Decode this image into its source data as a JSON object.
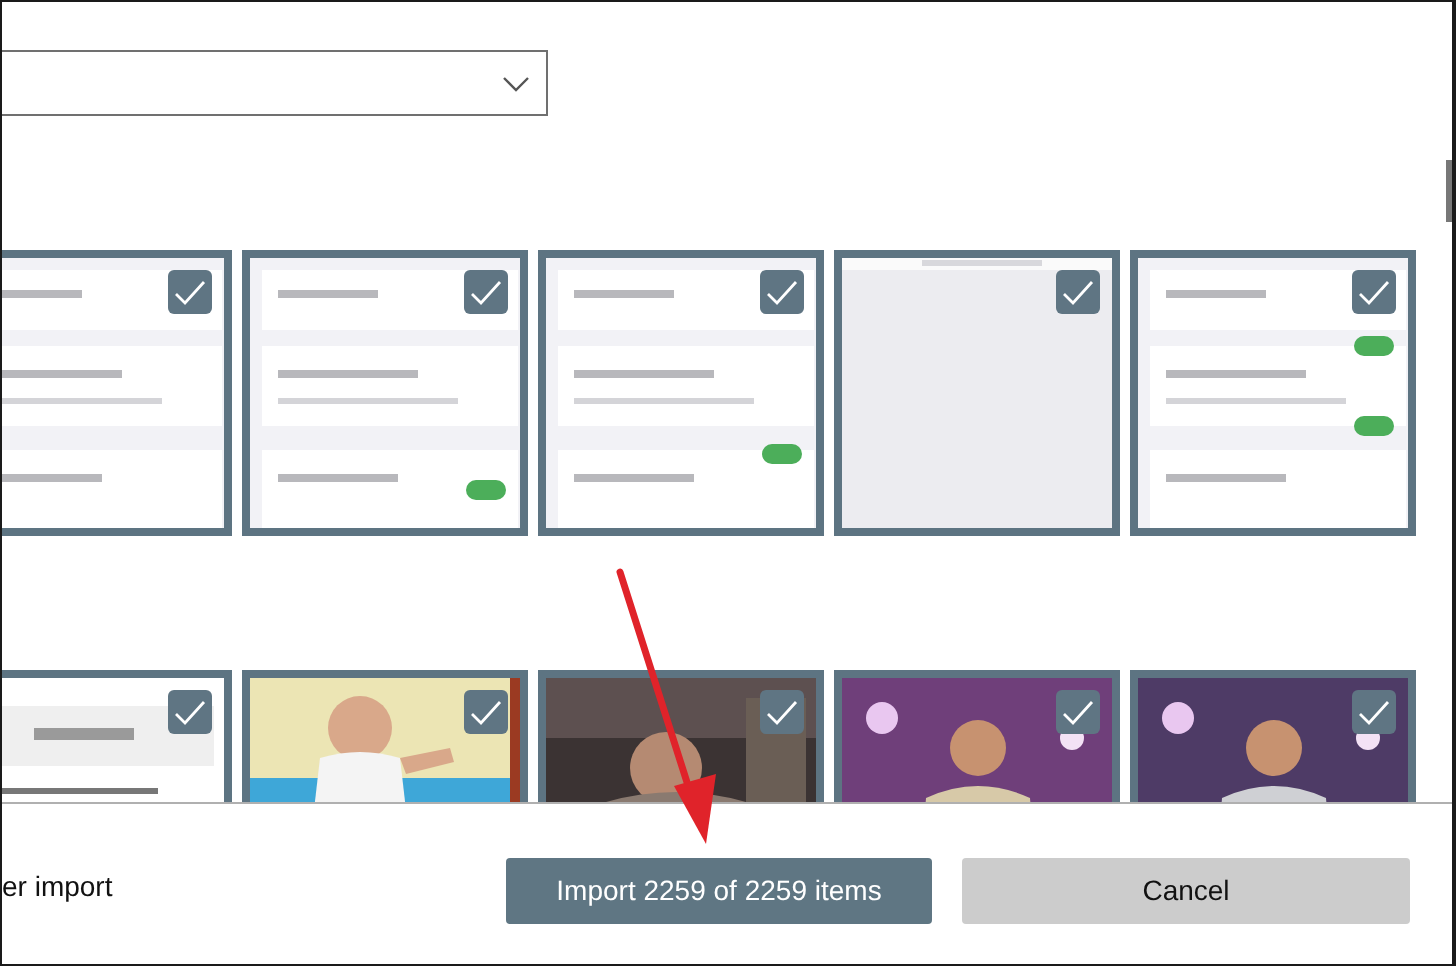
{
  "gallery": {
    "rows": [
      {
        "tiles": [
          {
            "kind": "picture",
            "checked": true
          },
          {
            "kind": "picture",
            "checked": true
          },
          {
            "kind": "picture",
            "checked": true
          },
          {
            "kind": "picture",
            "checked": true
          },
          {
            "kind": "picture",
            "checked": true
          }
        ]
      },
      {
        "tiles": [
          {
            "kind": "picture",
            "checked": true
          },
          {
            "kind": "picture",
            "checked": true
          },
          {
            "kind": "picture",
            "checked": true
          },
          {
            "kind": "picture",
            "checked": true
          },
          {
            "kind": "picture",
            "checked": true
          }
        ]
      }
    ]
  },
  "footer": {
    "option_text": "er import",
    "buttons": [
      {
        "label": "Import 2259 of 2259 items",
        "kind": "primary"
      },
      {
        "label": "Cancel",
        "kind": "secondary"
      }
    ]
  }
}
